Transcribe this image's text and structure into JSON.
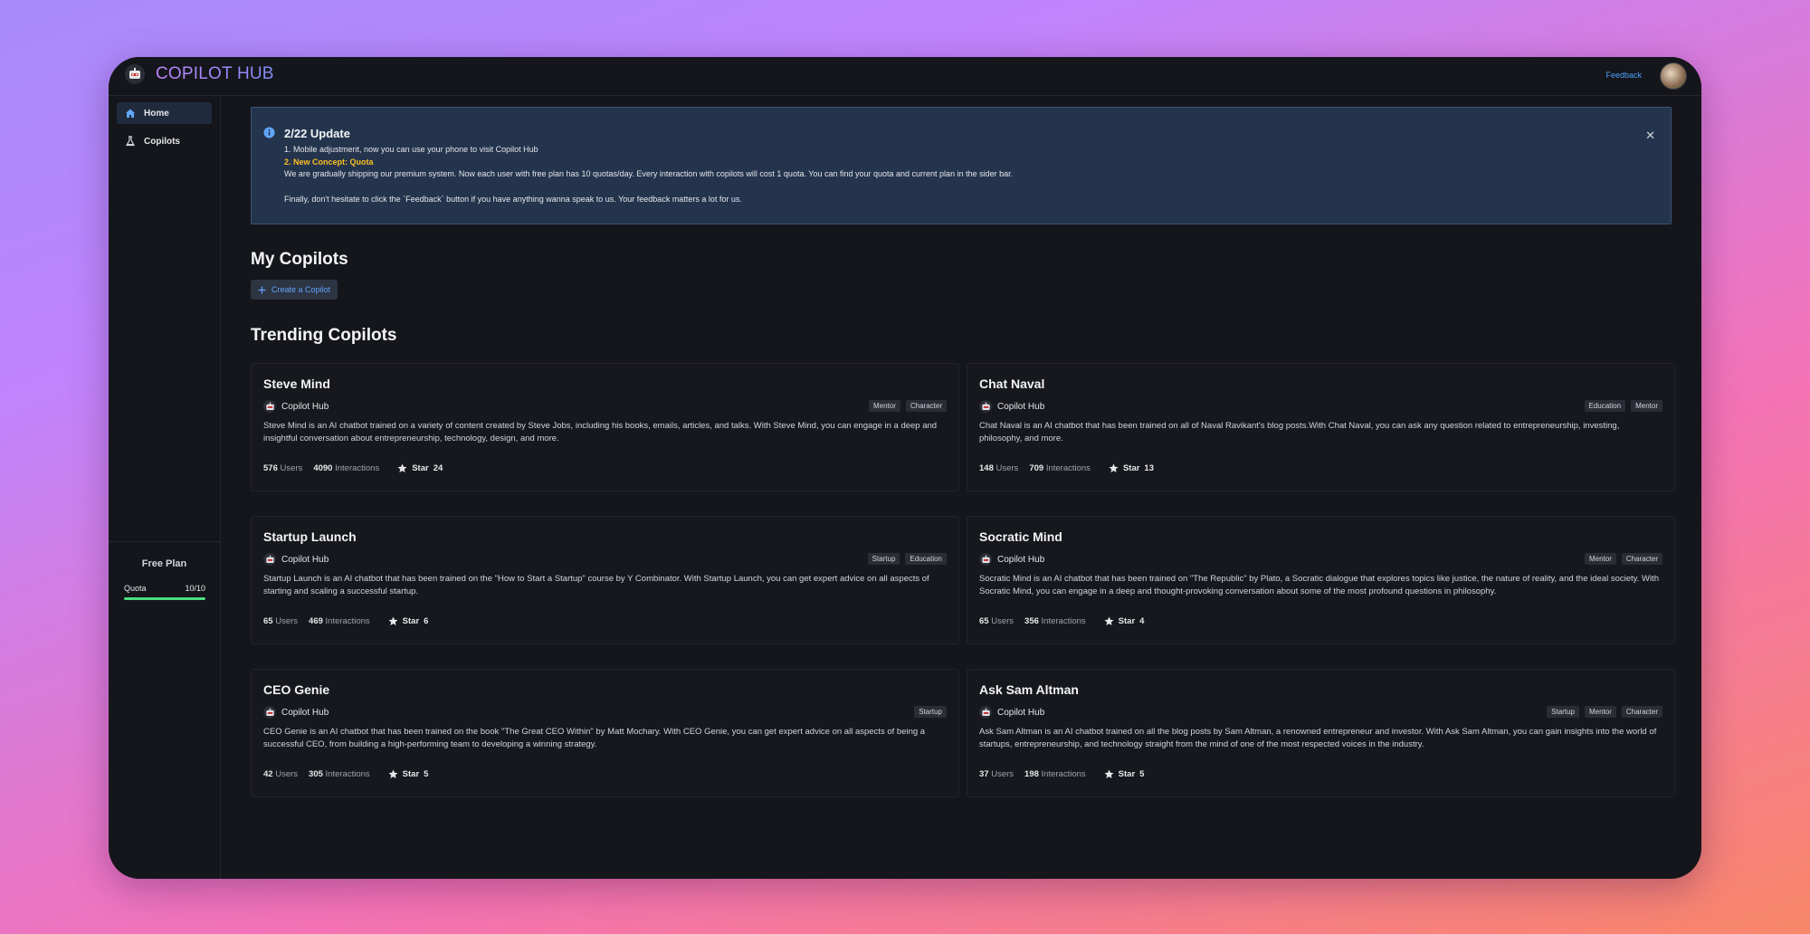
{
  "app": {
    "title": "COPILOT HUB",
    "feedback_label": "Feedback"
  },
  "sidebar": {
    "items": [
      {
        "label": "Home",
        "icon": "home-icon",
        "active": true
      },
      {
        "label": "Copilots",
        "icon": "flask-icon",
        "active": false
      }
    ],
    "plan": {
      "title": "Free Plan",
      "quota_label": "Quota",
      "quota_value": "10/10",
      "quota_fraction": 1.0
    }
  },
  "alert": {
    "title": "2/22 Update",
    "line1": "1. Mobile adjustment, now you can use your phone to visit Copilot Hub",
    "line2": "2. New Concept: Quota",
    "line3": "We are gradually shipping our premium system. Now each user with free plan has 10 quotas/day. Every interaction with copilots will cost 1 quota. You can find your quota and current plan in the sider bar.",
    "line4": "Finally, don't hesitate to click the `Feedback` button if you have anything wanna speak to us. Your feedback matters a lot for us."
  },
  "my_copilots": {
    "heading": "My Copilots",
    "create_label": "Create a Copilot"
  },
  "trending": {
    "heading": "Trending Copilots",
    "users_label": "Users",
    "interactions_label": "Interactions",
    "star_label": "Star",
    "cards": [
      {
        "title": "Steve Mind",
        "author": "Copilot Hub",
        "tags": [
          "Mentor",
          "Character"
        ],
        "desc": "Steve Mind is an AI chatbot trained on a variety of content created by Steve Jobs, including his books, emails, articles, and talks. With Steve Mind, you can engage in a deep and insightful conversation about entrepreneurship, technology, design, and more.",
        "users": "576",
        "interactions": "4090",
        "stars": "24"
      },
      {
        "title": "Chat Naval",
        "author": "Copilot Hub",
        "tags": [
          "Education",
          "Mentor"
        ],
        "desc": "Chat Naval is an AI chatbot that has been trained on all of Naval Ravikant's blog posts.With Chat Naval, you can ask any question related to entrepreneurship, investing, philosophy, and more.",
        "users": "148",
        "interactions": "709",
        "stars": "13"
      },
      {
        "title": "Startup Launch",
        "author": "Copilot Hub",
        "tags": [
          "Startup",
          "Education"
        ],
        "desc": "Startup Launch is an AI chatbot that has been trained on the \"How to Start a Startup\" course by Y Combinator. With Startup Launch, you can get expert advice on all aspects of starting and scaling a successful startup.",
        "users": "65",
        "interactions": "469",
        "stars": "6"
      },
      {
        "title": "Socratic Mind",
        "author": "Copilot Hub",
        "tags": [
          "Mentor",
          "Character"
        ],
        "desc": "Socratic Mind is an AI chatbot that has been trained on \"The Republic\" by Plato, a Socratic dialogue that explores topics like justice, the nature of reality, and the ideal society. With Socratic Mind, you can engage in a deep and thought-provoking conversation about some of the most profound questions in philosophy.",
        "users": "65",
        "interactions": "356",
        "stars": "4"
      },
      {
        "title": "CEO Genie",
        "author": "Copilot Hub",
        "tags": [
          "Startup"
        ],
        "desc": "CEO Genie is an AI chatbot that has been trained on the book \"The Great CEO Within\" by Matt Mochary. With CEO Genie, you can get expert advice on all aspects of being a successful CEO, from building a high-performing team to developing a winning strategy.",
        "users": "42",
        "interactions": "305",
        "stars": "5"
      },
      {
        "title": "Ask Sam Altman",
        "author": "Copilot Hub",
        "tags": [
          "Startup",
          "Mentor",
          "Character"
        ],
        "desc": "Ask Sam Altman is an AI chatbot trained on all the blog posts by Sam Altman, a renowned entrepreneur and investor. With Ask Sam Altman, you can gain insights into the world of startups, entrepreneurship, and technology straight from the mind of one of the most respected voices in the industry.",
        "users": "37",
        "interactions": "198",
        "stars": "5"
      }
    ]
  },
  "colors": {
    "accent": "#4ea1ff",
    "highlight": "#fbbf24",
    "quota_fill": "#4ade80",
    "alert_bg": "#24344d"
  }
}
